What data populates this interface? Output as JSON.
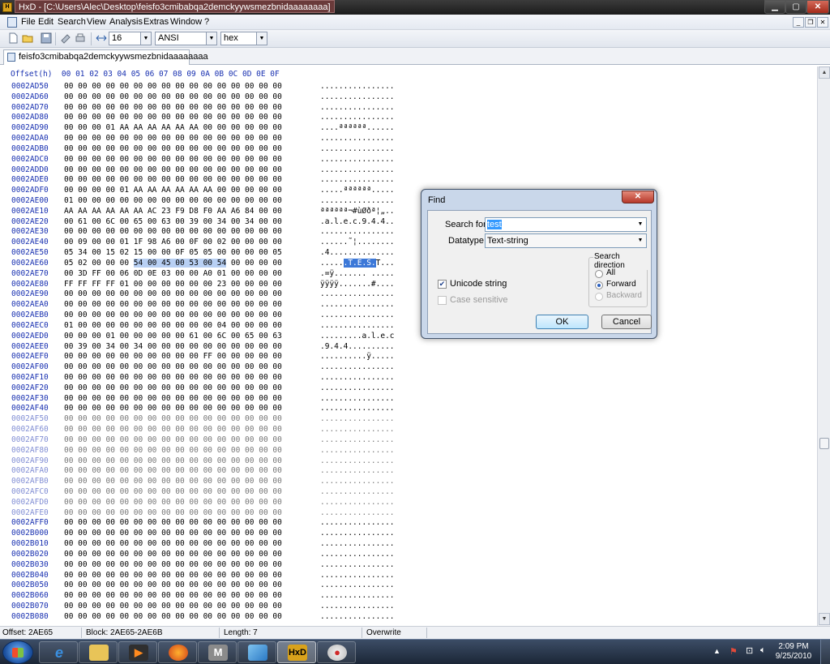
{
  "window": {
    "title": "HxD - [C:\\Users\\Alec\\Desktop\\feisfo3cmibabqa2demckyywsmezbnidaaaaaaaa]",
    "min_label": "▁",
    "max_label": "▢",
    "close_label": "✕"
  },
  "menu": {
    "items": [
      "File",
      "Edit",
      "Search",
      "View",
      "Analysis",
      "Extras",
      "Window",
      "?"
    ]
  },
  "toolbar": {
    "bytes_per_row": "16",
    "charset": "ANSI",
    "offset_base": "hex"
  },
  "tab": {
    "label": "feisfo3cmibabqa2demckyywsmezbnidaaaaaaaa"
  },
  "hex_header": "Offset(h)  00 01 02 03 04 05 06 07 08 09 0A 0B 0C 0D 0E 0F",
  "hex_rows": [
    {
      "offset": "0002AD50",
      "bytes": "00 00 00 00 00 00 00 00 00 00 00 00 00 00 00 00",
      "ascii": "................"
    },
    {
      "offset": "0002AD60",
      "bytes": "00 00 00 00 00 00 00 00 00 00 00 00 00 00 00 00",
      "ascii": "................"
    },
    {
      "offset": "0002AD70",
      "bytes": "00 00 00 00 00 00 00 00 00 00 00 00 00 00 00 00",
      "ascii": "................"
    },
    {
      "offset": "0002AD80",
      "bytes": "00 00 00 00 00 00 00 00 00 00 00 00 00 00 00 00",
      "ascii": "................"
    },
    {
      "offset": "0002AD90",
      "bytes": "00 00 00 01 AA AA AA AA AA AA 00 00 00 00 00 00",
      "ascii": "....ªªªªªª......"
    },
    {
      "offset": "0002ADA0",
      "bytes": "00 00 00 00 00 00 00 00 00 00 00 00 00 00 00 00",
      "ascii": "................"
    },
    {
      "offset": "0002ADB0",
      "bytes": "00 00 00 00 00 00 00 00 00 00 00 00 00 00 00 00",
      "ascii": "................"
    },
    {
      "offset": "0002ADC0",
      "bytes": "00 00 00 00 00 00 00 00 00 00 00 00 00 00 00 00",
      "ascii": "................"
    },
    {
      "offset": "0002ADD0",
      "bytes": "00 00 00 00 00 00 00 00 00 00 00 00 00 00 00 00",
      "ascii": "................"
    },
    {
      "offset": "0002ADE0",
      "bytes": "00 00 00 00 00 00 00 00 00 00 00 00 00 00 00 00",
      "ascii": "................"
    },
    {
      "offset": "0002ADF0",
      "bytes": "00 00 00 00 01 AA AA AA AA AA AA 00 00 00 00 00",
      "ascii": ".....ªªªªªª....."
    },
    {
      "offset": "0002AE00",
      "bytes": "01 00 00 00 00 00 00 00 00 00 00 00 00 00 00 00",
      "ascii": "................"
    },
    {
      "offset": "0002AE10",
      "bytes": "AA AA AA AA AA AA AC 23 F9 D8 F0 AA A6 84 00 00",
      "ascii": "ªªªªªª¬#ùØðª¦„.."
    },
    {
      "offset": "0002AE20",
      "bytes": "00 61 00 6C 00 65 00 63 00 39 00 34 00 34 00 00",
      "ascii": ".a.l.e.c.9.4.4.."
    },
    {
      "offset": "0002AE30",
      "bytes": "00 00 00 00 00 00 00 00 00 00 00 00 00 00 00 00",
      "ascii": "................"
    },
    {
      "offset": "0002AE40",
      "bytes": "00 09 00 00 01 1F 98 A6 00 0F 00 02 00 00 00 00",
      "ascii": "......˜¦........"
    },
    {
      "offset": "0002AE50",
      "bytes": "05 34 00 15 02 15 00 00 0F 05 05 00 00 00 00 05",
      "ascii": ".4.............."
    },
    {
      "offset": "0002AE60",
      "bytes": "05 02 00 00 00 54 00 45 00 53 00 54 00 00 00 00",
      "ascii": "......T.E.S.T...",
      "selected": true
    },
    {
      "offset": "0002AE70",
      "bytes": "00 3D FF 00 06 0D 0E 03 00 00 A0 01 00 00 00 00",
      "ascii": ".=ÿ....... ....."
    },
    {
      "offset": "0002AE80",
      "bytes": "FF FF FF FF 01 00 00 00 00 00 00 23 00 00 00 00",
      "ascii": "ÿÿÿÿ.......#...."
    },
    {
      "offset": "0002AE90",
      "bytes": "00 00 00 00 00 00 00 00 00 00 00 00 00 00 00 00",
      "ascii": "................"
    },
    {
      "offset": "0002AEA0",
      "bytes": "00 00 00 00 00 00 00 00 00 00 00 00 00 00 00 00",
      "ascii": "................"
    },
    {
      "offset": "0002AEB0",
      "bytes": "00 00 00 00 00 00 00 00 00 00 00 00 00 00 00 00",
      "ascii": "................"
    },
    {
      "offset": "0002AEC0",
      "bytes": "01 00 00 00 00 00 00 00 00 00 00 04 00 00 00 00",
      "ascii": "................"
    },
    {
      "offset": "0002AED0",
      "bytes": "00 00 00 01 00 00 00 00 00 61 00 6C 00 65 00 63",
      "ascii": ".........a.l.e.c"
    },
    {
      "offset": "0002AEE0",
      "bytes": "00 39 00 34 00 34 00 00 00 00 00 00 00 00 00 00",
      "ascii": ".9.4.4.........."
    },
    {
      "offset": "0002AEF0",
      "bytes": "00 00 00 00 00 00 00 00 00 00 FF 00 00 00 00 00",
      "ascii": "..........ÿ....."
    },
    {
      "offset": "0002AF00",
      "bytes": "00 00 00 00 00 00 00 00 00 00 00 00 00 00 00 00",
      "ascii": "................"
    },
    {
      "offset": "0002AF10",
      "bytes": "00 00 00 00 00 00 00 00 00 00 00 00 00 00 00 00",
      "ascii": "................"
    },
    {
      "offset": "0002AF20",
      "bytes": "00 00 00 00 00 00 00 00 00 00 00 00 00 00 00 00",
      "ascii": "................"
    },
    {
      "offset": "0002AF30",
      "bytes": "00 00 00 00 00 00 00 00 00 00 00 00 00 00 00 00",
      "ascii": "................"
    },
    {
      "offset": "0002AF40",
      "bytes": "00 00 00 00 00 00 00 00 00 00 00 00 00 00 00 00",
      "ascii": "................"
    },
    {
      "offset": "0002AF50",
      "bytes": "00 00 00 00 00 00 00 00 00 00 00 00 00 00 00 00",
      "ascii": "................",
      "faded": true
    },
    {
      "offset": "0002AF60",
      "bytes": "00 00 00 00 00 00 00 00 00 00 00 00 00 00 00 00",
      "ascii": "................",
      "faded": true
    },
    {
      "offset": "0002AF70",
      "bytes": "00 00 00 00 00 00 00 00 00 00 00 00 00 00 00 00",
      "ascii": "................",
      "faded": true
    },
    {
      "offset": "0002AF80",
      "bytes": "00 00 00 00 00 00 00 00 00 00 00 00 00 00 00 00",
      "ascii": "................",
      "faded": true
    },
    {
      "offset": "0002AF90",
      "bytes": "00 00 00 00 00 00 00 00 00 00 00 00 00 00 00 00",
      "ascii": "................",
      "faded": true
    },
    {
      "offset": "0002AFA0",
      "bytes": "00 00 00 00 00 00 00 00 00 00 00 00 00 00 00 00",
      "ascii": "................",
      "faded": true
    },
    {
      "offset": "0002AFB0",
      "bytes": "00 00 00 00 00 00 00 00 00 00 00 00 00 00 00 00",
      "ascii": "................",
      "faded": true
    },
    {
      "offset": "0002AFC0",
      "bytes": "00 00 00 00 00 00 00 00 00 00 00 00 00 00 00 00",
      "ascii": "................",
      "faded": true
    },
    {
      "offset": "0002AFD0",
      "bytes": "00 00 00 00 00 00 00 00 00 00 00 00 00 00 00 00",
      "ascii": "................",
      "faded": true
    },
    {
      "offset": "0002AFE0",
      "bytes": "00 00 00 00 00 00 00 00 00 00 00 00 00 00 00 00",
      "ascii": "................",
      "faded": true
    },
    {
      "offset": "0002AFF0",
      "bytes": "00 00 00 00 00 00 00 00 00 00 00 00 00 00 00 00",
      "ascii": "................"
    },
    {
      "offset": "0002B000",
      "bytes": "00 00 00 00 00 00 00 00 00 00 00 00 00 00 00 00",
      "ascii": "................"
    },
    {
      "offset": "0002B010",
      "bytes": "00 00 00 00 00 00 00 00 00 00 00 00 00 00 00 00",
      "ascii": "................"
    },
    {
      "offset": "0002B020",
      "bytes": "00 00 00 00 00 00 00 00 00 00 00 00 00 00 00 00",
      "ascii": "................"
    },
    {
      "offset": "0002B030",
      "bytes": "00 00 00 00 00 00 00 00 00 00 00 00 00 00 00 00",
      "ascii": "................"
    },
    {
      "offset": "0002B040",
      "bytes": "00 00 00 00 00 00 00 00 00 00 00 00 00 00 00 00",
      "ascii": "................"
    },
    {
      "offset": "0002B050",
      "bytes": "00 00 00 00 00 00 00 00 00 00 00 00 00 00 00 00",
      "ascii": "................"
    },
    {
      "offset": "0002B060",
      "bytes": "00 00 00 00 00 00 00 00 00 00 00 00 00 00 00 00",
      "ascii": "................"
    },
    {
      "offset": "0002B070",
      "bytes": "00 00 00 00 00 00 00 00 00 00 00 00 00 00 00 00",
      "ascii": "................"
    },
    {
      "offset": "0002B080",
      "bytes": "00 00 00 00 00 00 00 00 00 00 00 00 00 00 00 00",
      "ascii": "................"
    }
  ],
  "status": {
    "offset": "Offset: 2AE65",
    "block": "Block: 2AE65-2AE6B",
    "length": "Length: 7",
    "mode": "Overwrite"
  },
  "find_dialog": {
    "title": "Find",
    "close_label": "✕",
    "search_for_label": "Search for:",
    "search_for_value": "test",
    "datatype_label": "Datatype:",
    "datatype_value": "Text-string",
    "direction_label": "Search direction",
    "direction_options": [
      "All",
      "Forward",
      "Backward"
    ],
    "direction_selected": "Forward",
    "unicode_label": "Unicode string",
    "unicode_checked": true,
    "case_label": "Case sensitive",
    "case_checked": false,
    "ok_label": "OK",
    "cancel_label": "Cancel"
  },
  "taskbar": {
    "apps": [
      "internet-explorer-icon",
      "file-explorer-icon",
      "media-player-icon",
      "firefox-icon",
      "m-app-icon",
      "app-icon",
      "hxd-icon",
      "paint-icon"
    ],
    "time": "2:09 PM",
    "date": "9/25/2010"
  }
}
